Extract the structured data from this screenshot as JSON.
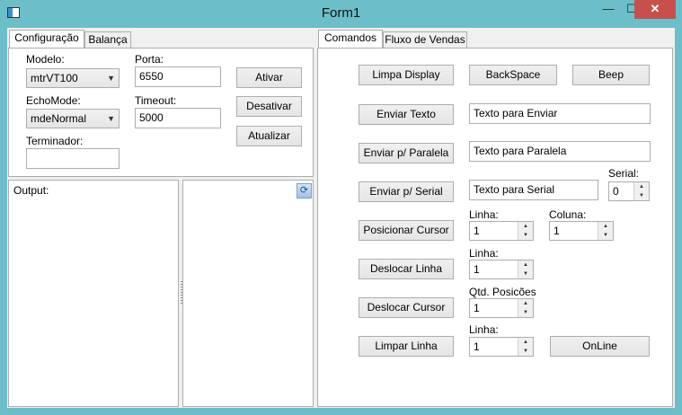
{
  "window": {
    "title": "Form1",
    "min_glyph": "—",
    "max_glyph": "☐",
    "close_glyph": "✕"
  },
  "left_tabs": {
    "tab1": "Configuração",
    "tab2": "Balança"
  },
  "config": {
    "modelo_label": "Modelo:",
    "modelo_value": "mtrVT100",
    "porta_label": "Porta:",
    "porta_value": "6550",
    "echomode_label": "EchoMode:",
    "echomode_value": "mdeNormal",
    "timeout_label": "Timeout:",
    "timeout_value": "5000",
    "terminador_label": "Terminador:",
    "terminador_value": "",
    "ativar": "Ativar",
    "desativar": "Desativar",
    "atualizar": "Atualizar",
    "arrow": "▼"
  },
  "output": {
    "label": "Output:",
    "refresh_icon": "⟳"
  },
  "right_tabs": {
    "tab1": "Comandos",
    "tab2": "Fluxo de Vendas"
  },
  "comandos": {
    "limpa_display": "Limpa Display",
    "backspace": "BackSpace",
    "beep": "Beep",
    "enviar_texto": "Enviar Texto",
    "texto_enviar": "Texto para Enviar",
    "enviar_paralela": "Enviar p/ Paralela",
    "texto_paralela": "Texto para Paralela",
    "serial_label": "Serial:",
    "serial_value": "0",
    "enviar_serial": "Enviar p/ Serial",
    "texto_serial": "Texto para Serial",
    "posicionar_cursor": "Posicionar Cursor",
    "linha_label": "Linha:",
    "coluna_label": "Coluna:",
    "pos_linha_value": "1",
    "pos_coluna_value": "1",
    "deslocar_linha": "Deslocar Linha",
    "desl_linha_label": "Linha:",
    "desl_linha_value": "1",
    "deslocar_cursor": "Deslocar Cursor",
    "qtd_label": "Qtd. Posicões",
    "qtd_value": "1",
    "limpar_linha": "Limpar Linha",
    "limpar_linha_label": "Linha:",
    "limpar_linha_value": "1",
    "online": "OnLine",
    "up_arrow": "▲",
    "down_arrow": "▼"
  }
}
